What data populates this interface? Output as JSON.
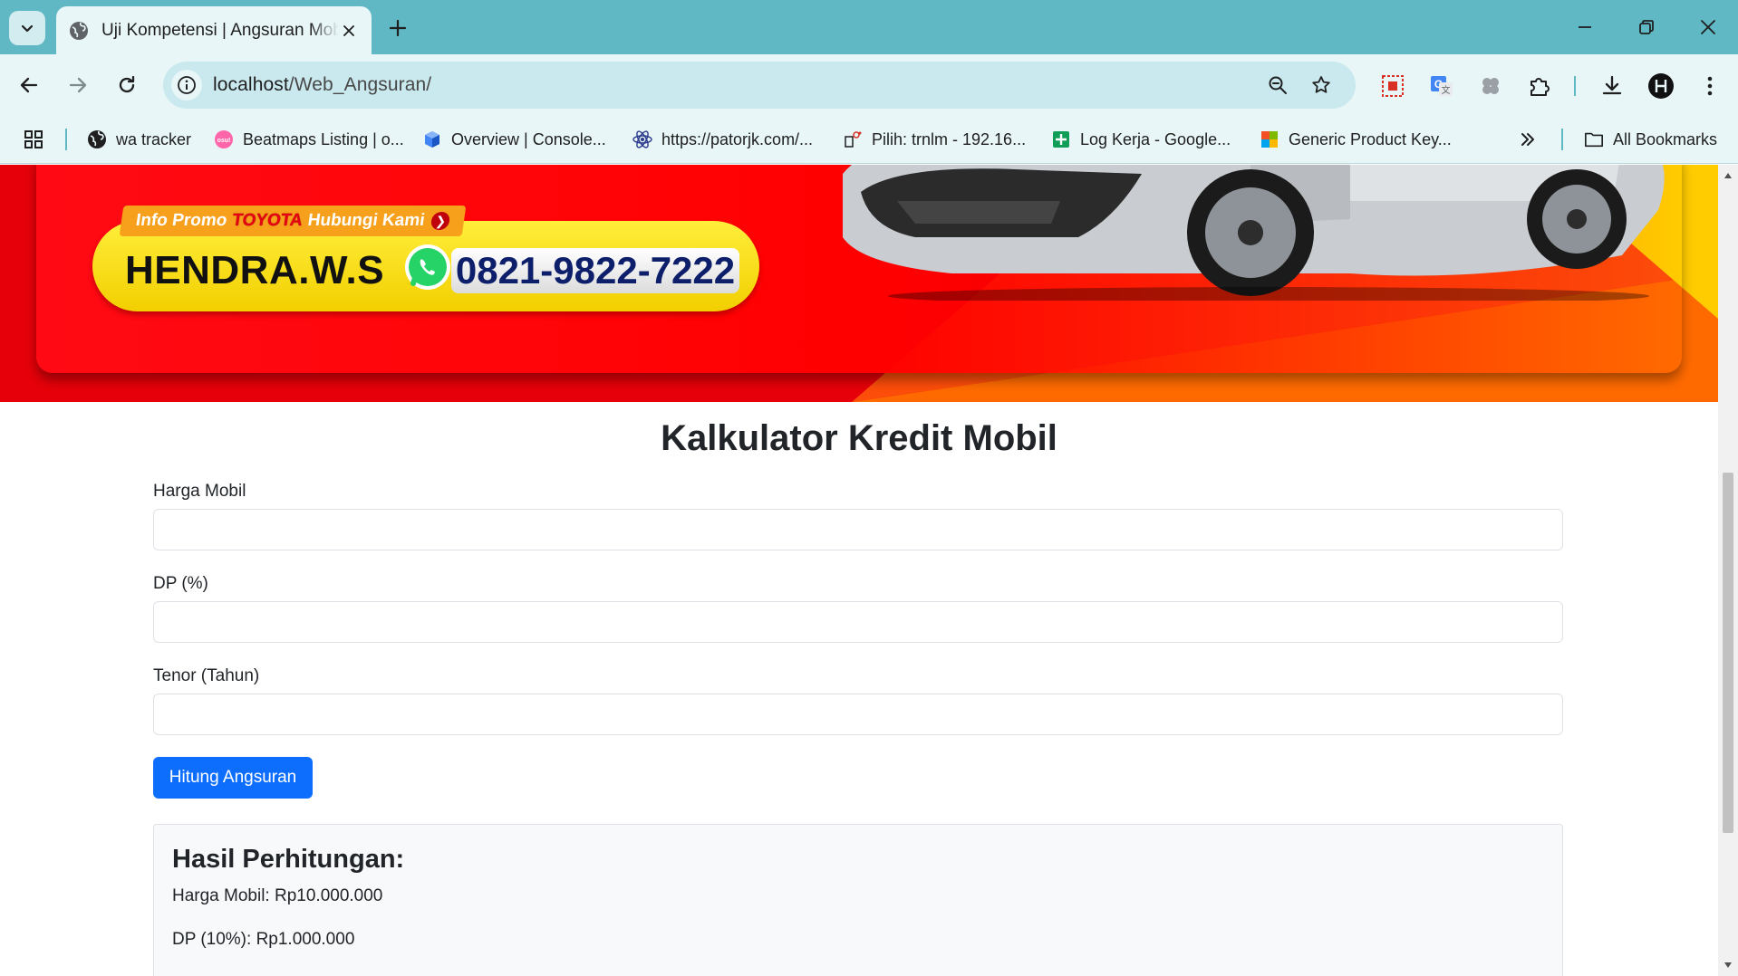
{
  "browser": {
    "tab_title": "Uji Kompetensi | Angsuran Mobil",
    "url_host": "localhost",
    "url_path": "/Web_Angsuran/",
    "bookmarks": [
      {
        "label": "wa tracker",
        "icon": "globe-icon"
      },
      {
        "label": "Beatmaps Listing | o...",
        "icon": "osu-icon"
      },
      {
        "label": "Overview | Console...",
        "icon": "cube-icon"
      },
      {
        "label": "https://patorjk.com/...",
        "icon": "react-icon"
      },
      {
        "label": "Pilih: trnlm - 192.16...",
        "icon": "phpmyadmin-icon"
      },
      {
        "label": "Log Kerja - Google...",
        "icon": "sheets-icon"
      },
      {
        "label": "Generic Product Key...",
        "icon": "office-icon"
      }
    ],
    "all_bookmarks_label": "All Bookmarks"
  },
  "banner": {
    "promo_prefix": "Info Promo",
    "promo_brand": "TOYOTA",
    "promo_suffix": "Hubungi Kami",
    "name": "HENDRA.W.S",
    "phone": "0821-9822-7222"
  },
  "form": {
    "title": "Kalkulator Kredit Mobil",
    "harga_label": "Harga Mobil",
    "harga_value": "",
    "dp_label": "DP (%)",
    "dp_value": "",
    "tenor_label": "Tenor (Tahun)",
    "tenor_value": "",
    "submit_label": "Hitung Angsuran"
  },
  "result": {
    "title": "Hasil Perhitungan:",
    "harga_line": "Harga Mobil: Rp10.000.000",
    "dp_line": "DP (10%): Rp1.000.000"
  },
  "colors": {
    "tab_strip": "#5fb8c4",
    "toolbar": "#e8f6f8",
    "primary_button": "#0d6efd",
    "banner_red": "#e8000a"
  }
}
